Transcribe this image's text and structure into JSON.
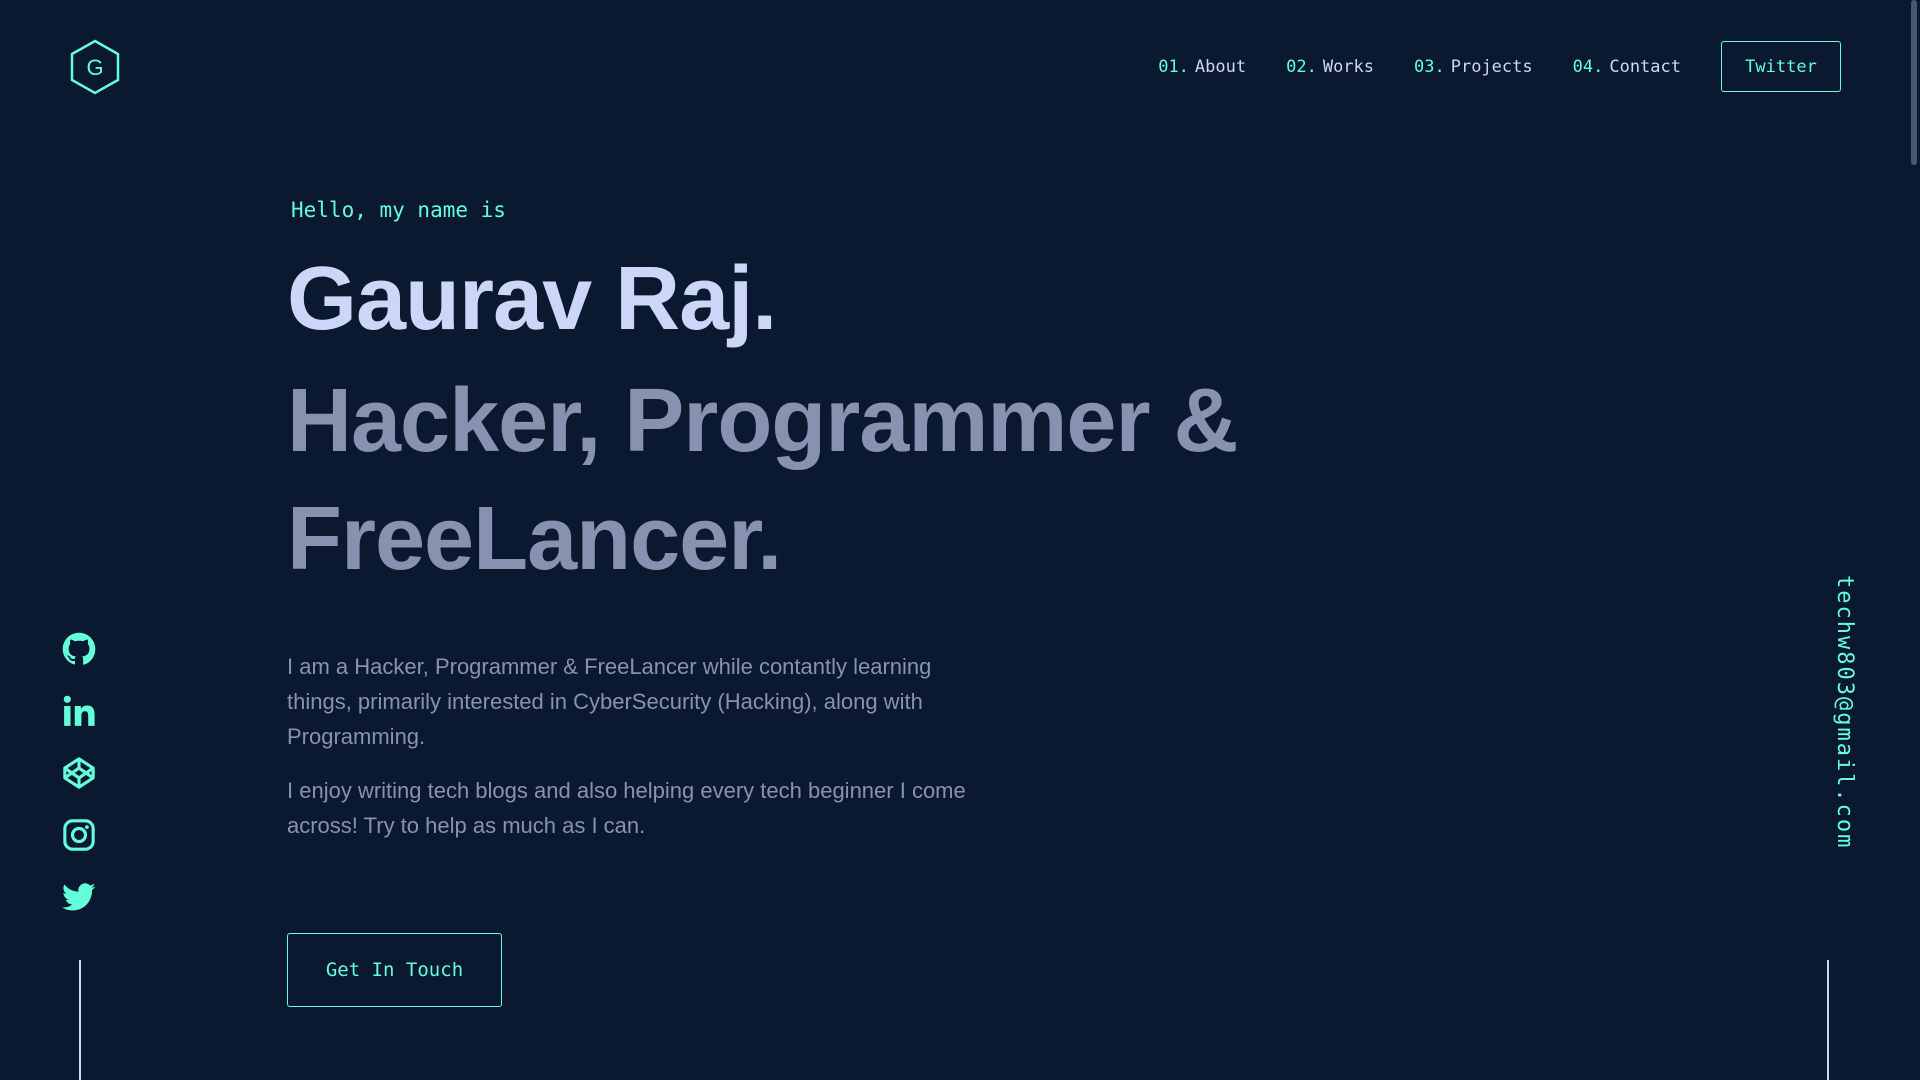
{
  "colors": {
    "background": "#0a192f",
    "accent": "#64ffda",
    "heading": "#ccd6f6",
    "text": "#8892b0"
  },
  "logo": {
    "letter": "G",
    "icon": "hexagon-logo-icon"
  },
  "nav": {
    "items": [
      {
        "num": "01.",
        "label": "About"
      },
      {
        "num": "02.",
        "label": "Works"
      },
      {
        "num": "03.",
        "label": "Projects"
      },
      {
        "num": "04.",
        "label": "Contact"
      }
    ],
    "button_label": "Twitter"
  },
  "hero": {
    "greeting": "Hello, my name is",
    "name": "Gaurav Raj.",
    "tagline": "Hacker, Programmer & FreeLancer.",
    "paragraphs": [
      "I am a Hacker, Programmer & FreeLancer while contantly learning things, primarily interested in CyberSecurity (Hacking), along with Programming.",
      "I enjoy writing tech blogs and also helping every tech beginner I come across! Try to help as much as I can."
    ],
    "cta_label": "Get In Touch"
  },
  "socials": [
    "github-icon",
    "linkedin-icon",
    "codepen-icon",
    "instagram-icon",
    "twitter-icon"
  ],
  "email": "techw803@gmail.com"
}
